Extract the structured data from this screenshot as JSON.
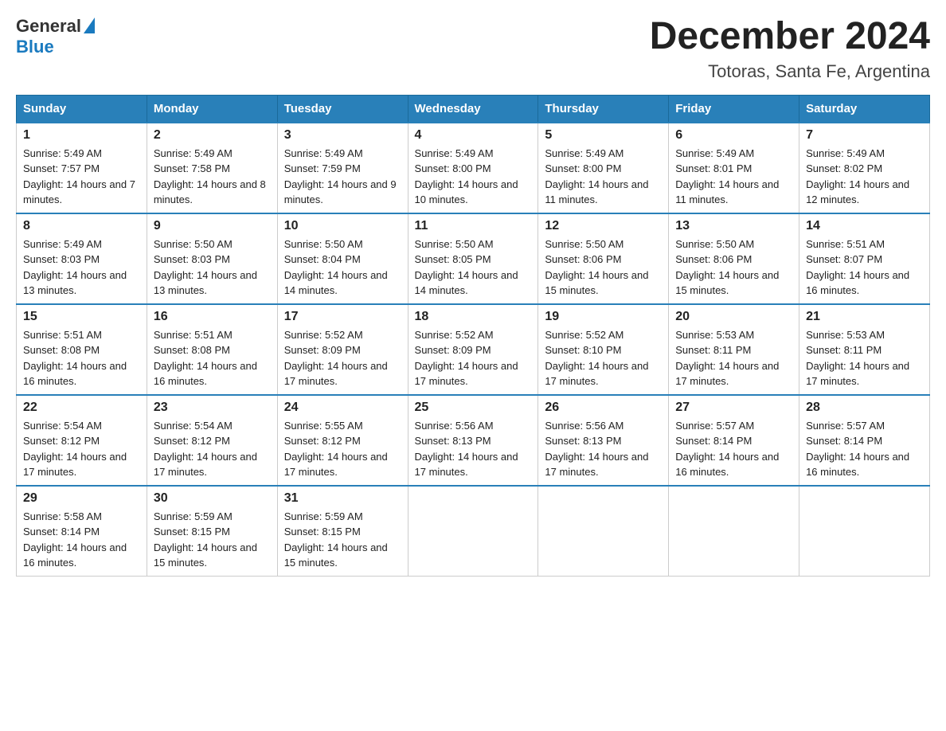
{
  "header": {
    "logo_general": "General",
    "logo_blue": "Blue",
    "month_title": "December 2024",
    "location": "Totoras, Santa Fe, Argentina"
  },
  "days_of_week": [
    "Sunday",
    "Monday",
    "Tuesday",
    "Wednesday",
    "Thursday",
    "Friday",
    "Saturday"
  ],
  "weeks": [
    [
      {
        "day": "1",
        "sunrise": "Sunrise: 5:49 AM",
        "sunset": "Sunset: 7:57 PM",
        "daylight": "Daylight: 14 hours and 7 minutes."
      },
      {
        "day": "2",
        "sunrise": "Sunrise: 5:49 AM",
        "sunset": "Sunset: 7:58 PM",
        "daylight": "Daylight: 14 hours and 8 minutes."
      },
      {
        "day": "3",
        "sunrise": "Sunrise: 5:49 AM",
        "sunset": "Sunset: 7:59 PM",
        "daylight": "Daylight: 14 hours and 9 minutes."
      },
      {
        "day": "4",
        "sunrise": "Sunrise: 5:49 AM",
        "sunset": "Sunset: 8:00 PM",
        "daylight": "Daylight: 14 hours and 10 minutes."
      },
      {
        "day": "5",
        "sunrise": "Sunrise: 5:49 AM",
        "sunset": "Sunset: 8:00 PM",
        "daylight": "Daylight: 14 hours and 11 minutes."
      },
      {
        "day": "6",
        "sunrise": "Sunrise: 5:49 AM",
        "sunset": "Sunset: 8:01 PM",
        "daylight": "Daylight: 14 hours and 11 minutes."
      },
      {
        "day": "7",
        "sunrise": "Sunrise: 5:49 AM",
        "sunset": "Sunset: 8:02 PM",
        "daylight": "Daylight: 14 hours and 12 minutes."
      }
    ],
    [
      {
        "day": "8",
        "sunrise": "Sunrise: 5:49 AM",
        "sunset": "Sunset: 8:03 PM",
        "daylight": "Daylight: 14 hours and 13 minutes."
      },
      {
        "day": "9",
        "sunrise": "Sunrise: 5:50 AM",
        "sunset": "Sunset: 8:03 PM",
        "daylight": "Daylight: 14 hours and 13 minutes."
      },
      {
        "day": "10",
        "sunrise": "Sunrise: 5:50 AM",
        "sunset": "Sunset: 8:04 PM",
        "daylight": "Daylight: 14 hours and 14 minutes."
      },
      {
        "day": "11",
        "sunrise": "Sunrise: 5:50 AM",
        "sunset": "Sunset: 8:05 PM",
        "daylight": "Daylight: 14 hours and 14 minutes."
      },
      {
        "day": "12",
        "sunrise": "Sunrise: 5:50 AM",
        "sunset": "Sunset: 8:06 PM",
        "daylight": "Daylight: 14 hours and 15 minutes."
      },
      {
        "day": "13",
        "sunrise": "Sunrise: 5:50 AM",
        "sunset": "Sunset: 8:06 PM",
        "daylight": "Daylight: 14 hours and 15 minutes."
      },
      {
        "day": "14",
        "sunrise": "Sunrise: 5:51 AM",
        "sunset": "Sunset: 8:07 PM",
        "daylight": "Daylight: 14 hours and 16 minutes."
      }
    ],
    [
      {
        "day": "15",
        "sunrise": "Sunrise: 5:51 AM",
        "sunset": "Sunset: 8:08 PM",
        "daylight": "Daylight: 14 hours and 16 minutes."
      },
      {
        "day": "16",
        "sunrise": "Sunrise: 5:51 AM",
        "sunset": "Sunset: 8:08 PM",
        "daylight": "Daylight: 14 hours and 16 minutes."
      },
      {
        "day": "17",
        "sunrise": "Sunrise: 5:52 AM",
        "sunset": "Sunset: 8:09 PM",
        "daylight": "Daylight: 14 hours and 17 minutes."
      },
      {
        "day": "18",
        "sunrise": "Sunrise: 5:52 AM",
        "sunset": "Sunset: 8:09 PM",
        "daylight": "Daylight: 14 hours and 17 minutes."
      },
      {
        "day": "19",
        "sunrise": "Sunrise: 5:52 AM",
        "sunset": "Sunset: 8:10 PM",
        "daylight": "Daylight: 14 hours and 17 minutes."
      },
      {
        "day": "20",
        "sunrise": "Sunrise: 5:53 AM",
        "sunset": "Sunset: 8:11 PM",
        "daylight": "Daylight: 14 hours and 17 minutes."
      },
      {
        "day": "21",
        "sunrise": "Sunrise: 5:53 AM",
        "sunset": "Sunset: 8:11 PM",
        "daylight": "Daylight: 14 hours and 17 minutes."
      }
    ],
    [
      {
        "day": "22",
        "sunrise": "Sunrise: 5:54 AM",
        "sunset": "Sunset: 8:12 PM",
        "daylight": "Daylight: 14 hours and 17 minutes."
      },
      {
        "day": "23",
        "sunrise": "Sunrise: 5:54 AM",
        "sunset": "Sunset: 8:12 PM",
        "daylight": "Daylight: 14 hours and 17 minutes."
      },
      {
        "day": "24",
        "sunrise": "Sunrise: 5:55 AM",
        "sunset": "Sunset: 8:12 PM",
        "daylight": "Daylight: 14 hours and 17 minutes."
      },
      {
        "day": "25",
        "sunrise": "Sunrise: 5:56 AM",
        "sunset": "Sunset: 8:13 PM",
        "daylight": "Daylight: 14 hours and 17 minutes."
      },
      {
        "day": "26",
        "sunrise": "Sunrise: 5:56 AM",
        "sunset": "Sunset: 8:13 PM",
        "daylight": "Daylight: 14 hours and 17 minutes."
      },
      {
        "day": "27",
        "sunrise": "Sunrise: 5:57 AM",
        "sunset": "Sunset: 8:14 PM",
        "daylight": "Daylight: 14 hours and 16 minutes."
      },
      {
        "day": "28",
        "sunrise": "Sunrise: 5:57 AM",
        "sunset": "Sunset: 8:14 PM",
        "daylight": "Daylight: 14 hours and 16 minutes."
      }
    ],
    [
      {
        "day": "29",
        "sunrise": "Sunrise: 5:58 AM",
        "sunset": "Sunset: 8:14 PM",
        "daylight": "Daylight: 14 hours and 16 minutes."
      },
      {
        "day": "30",
        "sunrise": "Sunrise: 5:59 AM",
        "sunset": "Sunset: 8:15 PM",
        "daylight": "Daylight: 14 hours and 15 minutes."
      },
      {
        "day": "31",
        "sunrise": "Sunrise: 5:59 AM",
        "sunset": "Sunset: 8:15 PM",
        "daylight": "Daylight: 14 hours and 15 minutes."
      },
      null,
      null,
      null,
      null
    ]
  ]
}
